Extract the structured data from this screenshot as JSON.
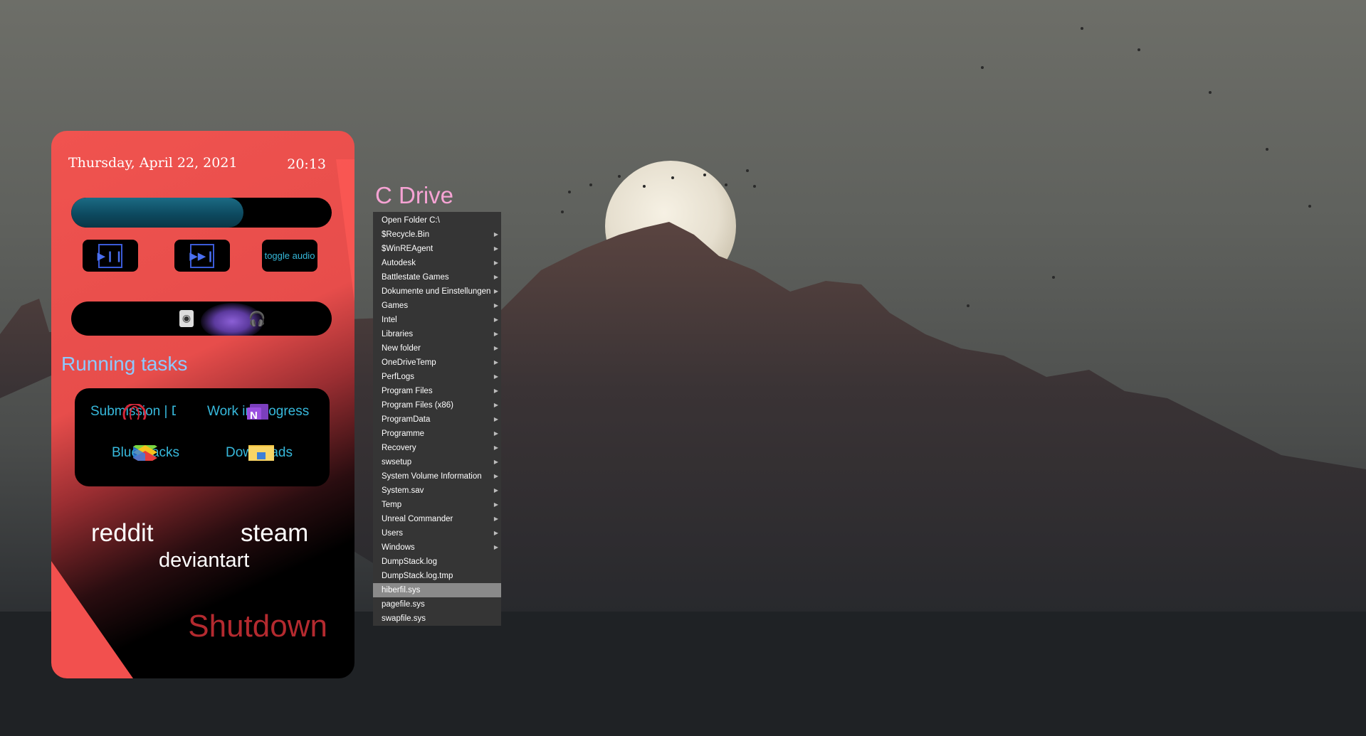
{
  "widget": {
    "date": "Thursday, April 22, 2021",
    "time": "20:13",
    "media_progress": 0.66,
    "media_buttons": {
      "play_pause_glyph": "▶❙❙",
      "next_glyph": "▶▶❙",
      "toggle_audio_label": "toggle audio"
    },
    "running_tasks_title": "Running tasks",
    "tasks": [
      {
        "label": "Submission | Dev",
        "icon": "opera-icon"
      },
      {
        "label": "Work in progress",
        "icon": "onenote-icon"
      },
      {
        "label": "BlueStacks",
        "icon": "bluestacks-icon"
      },
      {
        "label": "Downloads",
        "icon": "folder-icon"
      }
    ],
    "links": {
      "reddit": "reddit",
      "steam": "steam",
      "deviantart": "deviantart",
      "shutdown": "Shutdown"
    }
  },
  "cdrive": {
    "title": "C Drive",
    "items": [
      {
        "label": "Open Folder C:\\",
        "submenu": false
      },
      {
        "label": "$Recycle.Bin",
        "submenu": true
      },
      {
        "label": "$WinREAgent",
        "submenu": true
      },
      {
        "label": "Autodesk",
        "submenu": true
      },
      {
        "label": "Battlestate Games",
        "submenu": true
      },
      {
        "label": "Dokumente und Einstellungen",
        "submenu": true
      },
      {
        "label": "Games",
        "submenu": true
      },
      {
        "label": "Intel",
        "submenu": true
      },
      {
        "label": "Libraries",
        "submenu": true
      },
      {
        "label": "New folder",
        "submenu": true
      },
      {
        "label": "OneDriveTemp",
        "submenu": true
      },
      {
        "label": "PerfLogs",
        "submenu": true
      },
      {
        "label": "Program Files",
        "submenu": true
      },
      {
        "label": "Program Files (x86)",
        "submenu": true
      },
      {
        "label": "ProgramData",
        "submenu": true
      },
      {
        "label": "Programme",
        "submenu": true
      },
      {
        "label": "Recovery",
        "submenu": true
      },
      {
        "label": "swsetup",
        "submenu": true
      },
      {
        "label": "System Volume Information",
        "submenu": true
      },
      {
        "label": "System.sav",
        "submenu": true
      },
      {
        "label": "Temp",
        "submenu": true
      },
      {
        "label": "Unreal Commander",
        "submenu": true
      },
      {
        "label": "Users",
        "submenu": true
      },
      {
        "label": "Windows",
        "submenu": true
      },
      {
        "label": "DumpStack.log",
        "submenu": false
      },
      {
        "label": "DumpStack.log.tmp",
        "submenu": false
      },
      {
        "label": "hiberfil.sys",
        "submenu": false,
        "selected": true
      },
      {
        "label": "pagefile.sys",
        "submenu": false
      },
      {
        "label": "swapfile.sys",
        "submenu": false
      }
    ]
  },
  "colors": {
    "widget_red": "#e74d4b",
    "accent_cyan": "#37b9dc",
    "title_pink": "#f6a3d4",
    "shutdown_red": "#b42a2f",
    "running_blue": "#8dc9ff"
  }
}
